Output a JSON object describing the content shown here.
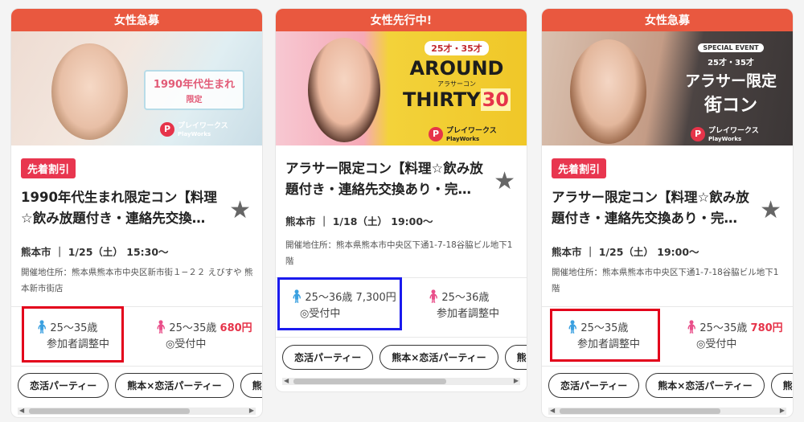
{
  "cards": [
    {
      "banner": "女性急募",
      "image_text": {
        "line1": "1990年代生まれ",
        "line2": "限定",
        "logo": "プレイワークス",
        "logo_sub": "PlayWorks"
      },
      "badge": "先着割引",
      "title": "1990年代生まれ限定コン【料理☆飲み放題付き・連絡先交換…",
      "location": "熊本市",
      "date": "1/25（土）",
      "time": "15:30〜",
      "address": "開催地住所：熊本県熊本市中央区新市街１−２２ えびすや 熊本新市街店",
      "male": {
        "age": "25〜35歳",
        "status": "参加者調整中"
      },
      "female": {
        "age": "25〜35歳",
        "price": "680円",
        "status": "◎受付中"
      },
      "tags": [
        "恋活パーティー",
        "熊本×恋活パーティー",
        "熊"
      ]
    },
    {
      "banner": "女性先行中!",
      "image_text": {
        "line1": "25才・35才",
        "line2": "AROUND",
        "line3": "アラサーコン",
        "line4": "THIRTY",
        "num": "30",
        "logo": "プレイワークス",
        "logo_sub": "PlayWorks"
      },
      "title": "アラサー限定コン【料理☆飲み放題付き・連絡先交換あり・完…",
      "location": "熊本市",
      "date": "1/18（土）",
      "time": "19:00〜",
      "address": "開催地住所：熊本県熊本市中央区下通1-7-18谷脇ビル地下1階",
      "male": {
        "age": "25〜36歳",
        "price": "7,300円",
        "status": "◎受付中"
      },
      "female": {
        "age": "25〜36歳",
        "status": "参加者調整中"
      },
      "tags": [
        "恋活パーティー",
        "熊本×恋活パーティー",
        "熊"
      ]
    },
    {
      "banner": "女性急募",
      "image_text": {
        "line0": "SPECIAL EVENT",
        "line1": "25才・35才",
        "line2": "アラサー限定",
        "line3": "街コン",
        "logo": "プレイワークス",
        "logo_sub": "PlayWorks"
      },
      "badge": "先着割引",
      "title": "アラサー限定コン【料理☆飲み放題付き・連絡先交換あり・完…",
      "location": "熊本市",
      "date": "1/25（土）",
      "time": "19:00〜",
      "address": "開催地住所：熊本県熊本市中央区下通1-7-18谷脇ビル地下1階",
      "male": {
        "age": "25〜35歳",
        "status": "参加者調整中"
      },
      "female": {
        "age": "25〜35歳",
        "price": "780円",
        "status": "◎受付中"
      },
      "tags": [
        "恋活パーティー",
        "熊本×恋活パーティー",
        "熊"
      ]
    }
  ],
  "colors": {
    "banner": "#e9583f",
    "accent_red": "#e6344a",
    "male_icon": "#3aa0e0",
    "female_icon": "#e94f8a",
    "highlight_red": "#e3001b",
    "highlight_blue": "#1a1aee"
  },
  "icons": {
    "favorite": "star-icon",
    "male": "male-person-icon",
    "female": "female-person-icon"
  }
}
